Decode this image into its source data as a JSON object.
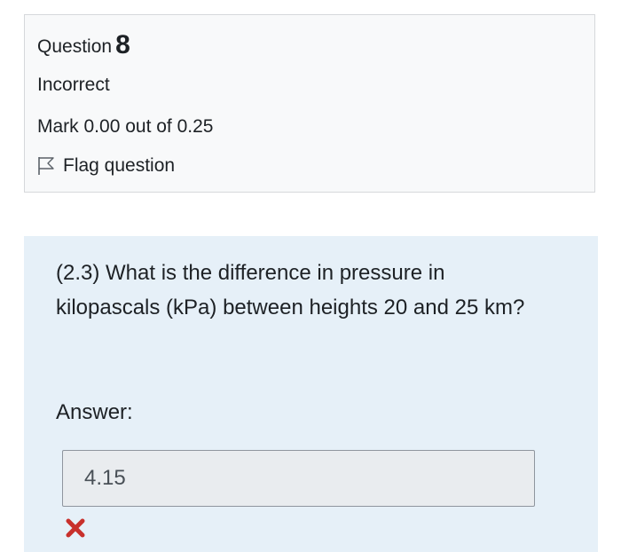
{
  "question": {
    "label": "Question",
    "number": "8",
    "state": "Incorrect",
    "grade": "Mark 0.00 out of 0.25",
    "flag_label": "Flag question"
  },
  "content": {
    "question_text": "(2.3) What is the difference in pressure in kilopascals (kPa) between heights 20 and 25 km?",
    "answer_label": "Answer:",
    "answer_value": "4.15"
  },
  "icons": {
    "flag": "flag-outline-icon",
    "incorrect": "red-cross-icon"
  },
  "colors": {
    "info_background": "#f8f9fa",
    "content_background": "#e6f0f8",
    "incorrect_mark": "#c8302c"
  }
}
